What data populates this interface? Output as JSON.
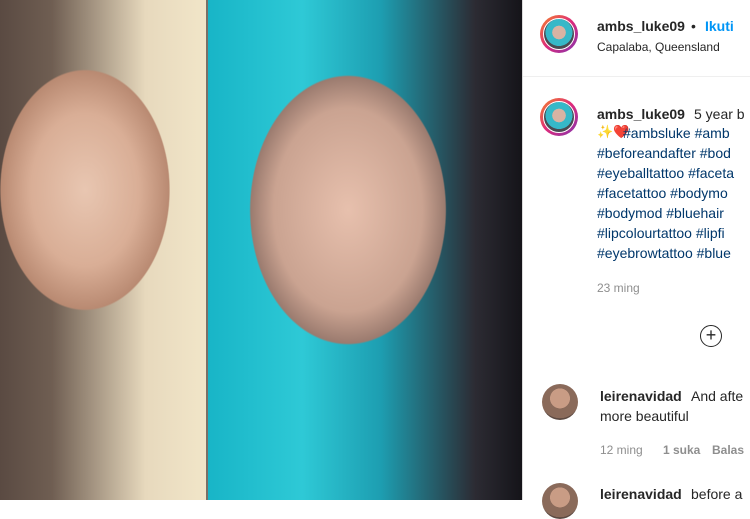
{
  "header": {
    "username": "ambs_luke09",
    "separator": "•",
    "follow": "Ikuti",
    "location": "Capalaba, Queensland"
  },
  "caption": {
    "username": "ambs_luke09",
    "text": "5 year b",
    "emojis": "✨❤️",
    "lines": [
      "#ambsluke #amb",
      "#beforeandafter #bod",
      "#eyeballtattoo #faceta",
      "#facetattoo #bodymo",
      "#bodymod #bluehair",
      "#lipcolourtattoo #lipfi",
      "#eyebrowtattoo #blue"
    ],
    "time": "23 ming"
  },
  "load_more_icon": "plus-circle-icon",
  "comments": [
    {
      "username": "leirenavidad",
      "text_line1": "And afte",
      "text_line2": "more beautiful",
      "time": "12 ming",
      "likes": "1 suka",
      "reply": "Balas"
    },
    {
      "username": "leirenavidad",
      "text_line1": "before a"
    }
  ]
}
